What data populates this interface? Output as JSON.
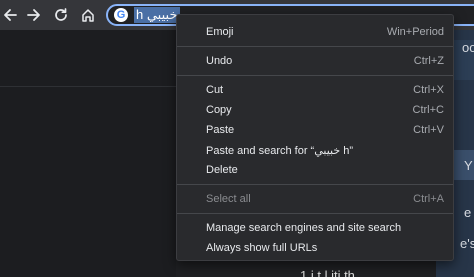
{
  "omnibox": {
    "query": "خبيبي h",
    "search_engine_icon": "google-g-icon"
  },
  "toolbar": {
    "back_icon": "arrow-left-icon",
    "forward_icon": "arrow-right-icon",
    "reload_icon": "reload-icon",
    "home_icon": "home-icon"
  },
  "context_menu": {
    "emoji": {
      "label": "Emoji",
      "shortcut": "Win+Period"
    },
    "undo": {
      "label": "Undo",
      "shortcut": "Ctrl+Z"
    },
    "cut": {
      "label": "Cut",
      "shortcut": "Ctrl+X"
    },
    "copy": {
      "label": "Copy",
      "shortcut": "Ctrl+C"
    },
    "paste": {
      "label": "Paste",
      "shortcut": "Ctrl+V"
    },
    "paste_and_search": {
      "label": "Paste and search for “خبيبي h”"
    },
    "delete": {
      "label": "Delete"
    },
    "select_all": {
      "label": "Select all",
      "shortcut": "Ctrl+A",
      "disabled": true
    },
    "manage_search_engines": {
      "label": "Manage search engines and site search"
    },
    "always_show_full_urls": {
      "label": "Always show full URLs"
    }
  },
  "background": {
    "fragment_1": "oo",
    "fragment_2": "Y",
    "fragment_3": "y",
    "fragment_4": "e",
    "fragment_5": "e's",
    "bottom_fragment": "1 i  t     l      iti      th"
  },
  "colors": {
    "accent": "#8ab4f8",
    "menu_bg": "#292a2d",
    "toolbar_bg": "#35363a"
  }
}
